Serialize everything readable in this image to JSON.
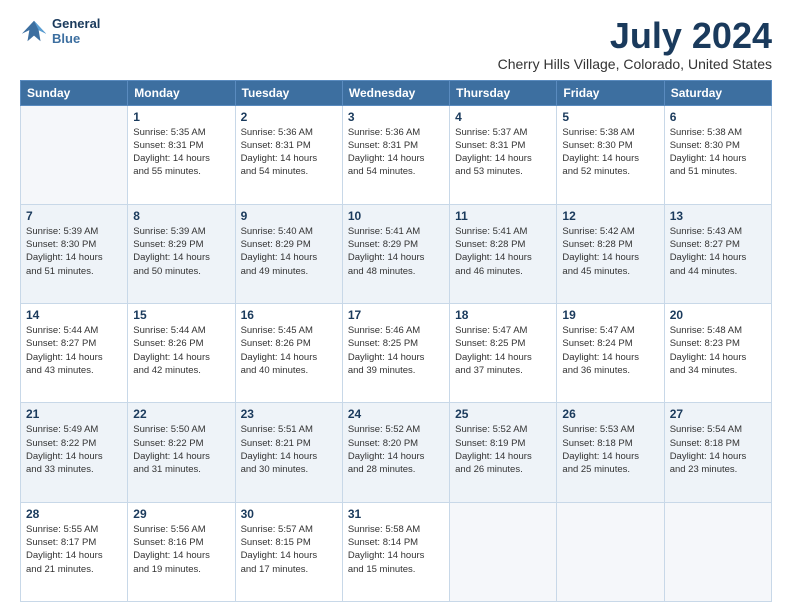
{
  "logo": {
    "line1": "General",
    "line2": "Blue"
  },
  "title": "July 2024",
  "subtitle": "Cherry Hills Village, Colorado, United States",
  "weekdays": [
    "Sunday",
    "Monday",
    "Tuesday",
    "Wednesday",
    "Thursday",
    "Friday",
    "Saturday"
  ],
  "weeks": [
    [
      {
        "day": "",
        "info": ""
      },
      {
        "day": "1",
        "info": "Sunrise: 5:35 AM\nSunset: 8:31 PM\nDaylight: 14 hours\nand 55 minutes."
      },
      {
        "day": "2",
        "info": "Sunrise: 5:36 AM\nSunset: 8:31 PM\nDaylight: 14 hours\nand 54 minutes."
      },
      {
        "day": "3",
        "info": "Sunrise: 5:36 AM\nSunset: 8:31 PM\nDaylight: 14 hours\nand 54 minutes."
      },
      {
        "day": "4",
        "info": "Sunrise: 5:37 AM\nSunset: 8:31 PM\nDaylight: 14 hours\nand 53 minutes."
      },
      {
        "day": "5",
        "info": "Sunrise: 5:38 AM\nSunset: 8:30 PM\nDaylight: 14 hours\nand 52 minutes."
      },
      {
        "day": "6",
        "info": "Sunrise: 5:38 AM\nSunset: 8:30 PM\nDaylight: 14 hours\nand 51 minutes."
      }
    ],
    [
      {
        "day": "7",
        "info": "Sunrise: 5:39 AM\nSunset: 8:30 PM\nDaylight: 14 hours\nand 51 minutes."
      },
      {
        "day": "8",
        "info": "Sunrise: 5:39 AM\nSunset: 8:29 PM\nDaylight: 14 hours\nand 50 minutes."
      },
      {
        "day": "9",
        "info": "Sunrise: 5:40 AM\nSunset: 8:29 PM\nDaylight: 14 hours\nand 49 minutes."
      },
      {
        "day": "10",
        "info": "Sunrise: 5:41 AM\nSunset: 8:29 PM\nDaylight: 14 hours\nand 48 minutes."
      },
      {
        "day": "11",
        "info": "Sunrise: 5:41 AM\nSunset: 8:28 PM\nDaylight: 14 hours\nand 46 minutes."
      },
      {
        "day": "12",
        "info": "Sunrise: 5:42 AM\nSunset: 8:28 PM\nDaylight: 14 hours\nand 45 minutes."
      },
      {
        "day": "13",
        "info": "Sunrise: 5:43 AM\nSunset: 8:27 PM\nDaylight: 14 hours\nand 44 minutes."
      }
    ],
    [
      {
        "day": "14",
        "info": "Sunrise: 5:44 AM\nSunset: 8:27 PM\nDaylight: 14 hours\nand 43 minutes."
      },
      {
        "day": "15",
        "info": "Sunrise: 5:44 AM\nSunset: 8:26 PM\nDaylight: 14 hours\nand 42 minutes."
      },
      {
        "day": "16",
        "info": "Sunrise: 5:45 AM\nSunset: 8:26 PM\nDaylight: 14 hours\nand 40 minutes."
      },
      {
        "day": "17",
        "info": "Sunrise: 5:46 AM\nSunset: 8:25 PM\nDaylight: 14 hours\nand 39 minutes."
      },
      {
        "day": "18",
        "info": "Sunrise: 5:47 AM\nSunset: 8:25 PM\nDaylight: 14 hours\nand 37 minutes."
      },
      {
        "day": "19",
        "info": "Sunrise: 5:47 AM\nSunset: 8:24 PM\nDaylight: 14 hours\nand 36 minutes."
      },
      {
        "day": "20",
        "info": "Sunrise: 5:48 AM\nSunset: 8:23 PM\nDaylight: 14 hours\nand 34 minutes."
      }
    ],
    [
      {
        "day": "21",
        "info": "Sunrise: 5:49 AM\nSunset: 8:22 PM\nDaylight: 14 hours\nand 33 minutes."
      },
      {
        "day": "22",
        "info": "Sunrise: 5:50 AM\nSunset: 8:22 PM\nDaylight: 14 hours\nand 31 minutes."
      },
      {
        "day": "23",
        "info": "Sunrise: 5:51 AM\nSunset: 8:21 PM\nDaylight: 14 hours\nand 30 minutes."
      },
      {
        "day": "24",
        "info": "Sunrise: 5:52 AM\nSunset: 8:20 PM\nDaylight: 14 hours\nand 28 minutes."
      },
      {
        "day": "25",
        "info": "Sunrise: 5:52 AM\nSunset: 8:19 PM\nDaylight: 14 hours\nand 26 minutes."
      },
      {
        "day": "26",
        "info": "Sunrise: 5:53 AM\nSunset: 8:18 PM\nDaylight: 14 hours\nand 25 minutes."
      },
      {
        "day": "27",
        "info": "Sunrise: 5:54 AM\nSunset: 8:18 PM\nDaylight: 14 hours\nand 23 minutes."
      }
    ],
    [
      {
        "day": "28",
        "info": "Sunrise: 5:55 AM\nSunset: 8:17 PM\nDaylight: 14 hours\nand 21 minutes."
      },
      {
        "day": "29",
        "info": "Sunrise: 5:56 AM\nSunset: 8:16 PM\nDaylight: 14 hours\nand 19 minutes."
      },
      {
        "day": "30",
        "info": "Sunrise: 5:57 AM\nSunset: 8:15 PM\nDaylight: 14 hours\nand 17 minutes."
      },
      {
        "day": "31",
        "info": "Sunrise: 5:58 AM\nSunset: 8:14 PM\nDaylight: 14 hours\nand 15 minutes."
      },
      {
        "day": "",
        "info": ""
      },
      {
        "day": "",
        "info": ""
      },
      {
        "day": "",
        "info": ""
      }
    ]
  ]
}
